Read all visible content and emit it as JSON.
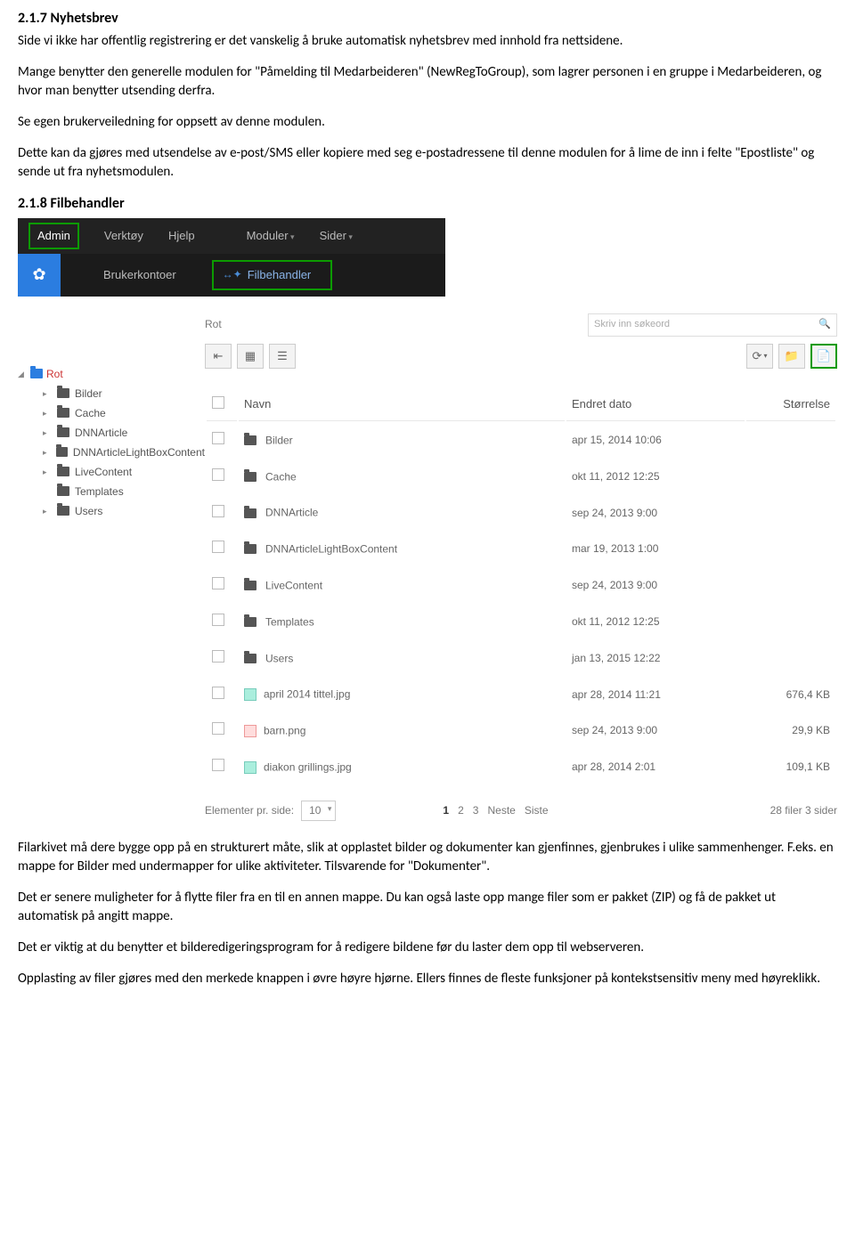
{
  "sec217": {
    "heading": "2.1.7  Nyhetsbrev",
    "p1": "Side vi ikke har offentlig registrering er det vanskelig å bruke automatisk nyhetsbrev med innhold fra nettsidene.",
    "p2": "Mange benytter den generelle modulen for \"Påmelding til Medarbeideren\" (NewRegToGroup), som lagrer personen i en gruppe i Medarbeideren, og hvor man benytter utsending derfra.",
    "p3": "Se egen brukerveiledning for oppsett av denne modulen.",
    "p4": "Dette kan da gjøres med utsendelse av e-post/SMS eller kopiere med seg e-postadressene til denne modulen for å lime de inn i felte \"Epostliste\" og sende ut fra nyhetsmodulen."
  },
  "sec218": {
    "heading": "2.1.8  Filbehandler"
  },
  "toolbar": {
    "admin": "Admin",
    "verktoy": "Verktøy",
    "hjelp": "Hjelp",
    "moduler": "Moduler",
    "sider": "Sider",
    "brukerkontoer": "Brukerkontoer",
    "filbehandler": "Filbehandler"
  },
  "fm": {
    "rot_label": "Rot",
    "search_placeholder": "Skriv inn søkeord",
    "tree": {
      "root": "Rot",
      "children": [
        "Bilder",
        "Cache",
        "DNNArticle",
        "DNNArticleLightBoxContent",
        "LiveContent",
        "Templates",
        "Users"
      ]
    },
    "columns": {
      "name": "Navn",
      "date": "Endret dato",
      "size": "Størrelse"
    },
    "rows": [
      {
        "type": "folder",
        "name": "Bilder",
        "date": "apr 15, 2014 10:06",
        "size": ""
      },
      {
        "type": "folder",
        "name": "Cache",
        "date": "okt 11, 2012 12:25",
        "size": ""
      },
      {
        "type": "folder",
        "name": "DNNArticle",
        "date": "sep 24, 2013 9:00",
        "size": ""
      },
      {
        "type": "folder",
        "name": "DNNArticleLightBoxContent",
        "date": "mar 19, 2013 1:00",
        "size": ""
      },
      {
        "type": "folder",
        "name": "LiveContent",
        "date": "sep 24, 2013 9:00",
        "size": ""
      },
      {
        "type": "folder",
        "name": "Templates",
        "date": "okt 11, 2012 12:25",
        "size": ""
      },
      {
        "type": "folder",
        "name": "Users",
        "date": "jan 13, 2015 12:22",
        "size": ""
      },
      {
        "type": "img",
        "name": "april 2014 tittel.jpg",
        "date": "apr 28, 2014 11:21",
        "size": "676,4 KB"
      },
      {
        "type": "png",
        "name": "barn.png",
        "date": "sep 24, 2013 9:00",
        "size": "29,9 KB"
      },
      {
        "type": "img",
        "name": "diakon grillings.jpg",
        "date": "apr 28, 2014 2:01",
        "size": "109,1 KB"
      }
    ],
    "footer": {
      "perpage_label": "Elementer pr. side:",
      "perpage_value": "10",
      "pages": [
        "1",
        "2",
        "3"
      ],
      "next": "Neste",
      "last": "Siste",
      "summary": "28 filer 3 sider"
    }
  },
  "bodytext": {
    "p1": "Filarkivet må dere bygge opp på en strukturert måte, slik at opplastet bilder og dokumenter kan gjenfinnes, gjenbrukes i ulike sammenhenger. F.eks. en mappe for Bilder med undermapper for ulike aktiviteter. Tilsvarende for \"Dokumenter\".",
    "p2": "Det er senere muligheter for å flytte filer fra en til en annen mappe. Du kan også laste opp mange filer som er pakket (ZIP) og få de pakket ut automatisk på angitt mappe.",
    "p3": "Det er viktig at du benytter et bilderedigeringsprogram for å redigere bildene før du laster dem opp til webserveren.",
    "p4": "Opplasting av filer gjøres med den merkede knappen i øvre høyre hjørne. Ellers finnes de fleste funksjoner på kontekstsensitiv meny med høyreklikk."
  }
}
